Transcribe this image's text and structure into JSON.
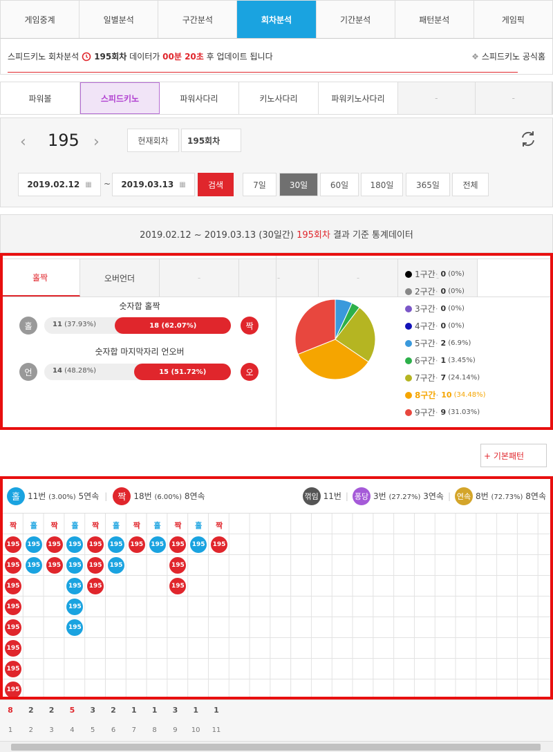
{
  "topnav": [
    "게임중계",
    "일별분석",
    "구간분석",
    "회차분석",
    "기간분석",
    "패턴분석",
    "게임픽"
  ],
  "info": {
    "prefix": "스피드키노 회차분석",
    "round": "195회차",
    "mid": "데이터가",
    "time": "00분 20초",
    "suffix": "후 업데이트 됩니다",
    "official": "스피드키노 공식홈"
  },
  "subnav": [
    "파워볼",
    "스피드키노",
    "파워사다리",
    "키노사다리",
    "파워키노사다리",
    "-",
    "-"
  ],
  "control": {
    "round": "195",
    "current_btn": "현재회차",
    "round_input": "195회차",
    "date_from": "2019.02.12",
    "tilde": "~",
    "date_to": "2019.03.13",
    "search": "검색",
    "periods": [
      "7일",
      "30일",
      "60일",
      "180일",
      "365일",
      "전체"
    ]
  },
  "summary": {
    "range": "2019.02.12 ~ 2019.03.13 (30일간)",
    "round": "195회차",
    "suffix": "결과 기준 통계데이터"
  },
  "oddeven": {
    "title": "숫자합 홀짝",
    "left_badge": "홀",
    "left_count": "11",
    "left_pct": "(37.93%)",
    "right_count": "18",
    "right_pct": "(62.07%)",
    "right_badge": "짝",
    "right_share": 62.07
  },
  "underover": {
    "title": "숫자합 마지막자리 언오버",
    "left_badge": "언",
    "left_count": "14",
    "left_pct": "(48.28%)",
    "right_count": "15",
    "right_pct": "(51.72%)",
    "right_badge": "오",
    "right_share": 51.72
  },
  "chart_data": {
    "type": "pie",
    "labels": [
      "1구간",
      "2구간",
      "3구간",
      "4구간",
      "5구간",
      "6구간",
      "7구간",
      "8구간",
      "9구간"
    ],
    "values": [
      0,
      0,
      0,
      0,
      2,
      1,
      7,
      10,
      9
    ],
    "percents": [
      "(0%)",
      "(0%)",
      "(0%)",
      "(0%)",
      "(6.9%)",
      "(3.45%)",
      "(24.14%)",
      "(34.48%)",
      "(31.03%)"
    ],
    "colors": [
      "#000000",
      "#888888",
      "#7b57c8",
      "#1212b8",
      "#3a99dc",
      "#2db04a",
      "#b5b522",
      "#f5a500",
      "#e8473e"
    ],
    "highlight": "8구간"
  },
  "tabs": [
    "홀짝",
    "오버언더",
    "-",
    "-",
    "-",
    "-"
  ],
  "pattern_btn": "+ 기본패턴",
  "stats": {
    "odd_badge": "홀",
    "odd_text": "11번",
    "odd_pct": "(3.00%)",
    "odd_streak": "5연속",
    "even_badge": "짝",
    "even_text": "18번",
    "even_pct": "(6.00%)",
    "even_streak": "8연속",
    "break_badge": "꺾임",
    "break_text": "11번",
    "bounce_badge": "퐁당",
    "bounce_text": "3번",
    "bounce_pct": "(27.27%)",
    "bounce_streak": "3연속",
    "cont_badge": "연속",
    "cont_text": "8번",
    "cont_pct": "(72.73%)",
    "cont_streak": "8연속"
  },
  "grid": {
    "ball_label": "195",
    "columns": [
      {
        "h": "짝",
        "t": "e",
        "n": 8
      },
      {
        "h": "홀",
        "t": "o",
        "n": 2
      },
      {
        "h": "짝",
        "t": "e",
        "n": 2
      },
      {
        "h": "홀",
        "t": "o",
        "n": 5
      },
      {
        "h": "짝",
        "t": "e",
        "n": 3
      },
      {
        "h": "홀",
        "t": "o",
        "n": 2
      },
      {
        "h": "짝",
        "t": "e",
        "n": 1
      },
      {
        "h": "홀",
        "t": "o",
        "n": 1
      },
      {
        "h": "짝",
        "t": "e",
        "n": 3
      },
      {
        "h": "홀",
        "t": "o",
        "n": 1
      },
      {
        "h": "짝",
        "t": "e",
        "n": 1
      }
    ]
  },
  "footer": {
    "counts": [
      "8",
      "2",
      "2",
      "5",
      "3",
      "2",
      "1",
      "1",
      "3",
      "1",
      "1"
    ],
    "index": [
      "1",
      "2",
      "3",
      "4",
      "5",
      "6",
      "7",
      "8",
      "9",
      "10",
      "11"
    ]
  }
}
